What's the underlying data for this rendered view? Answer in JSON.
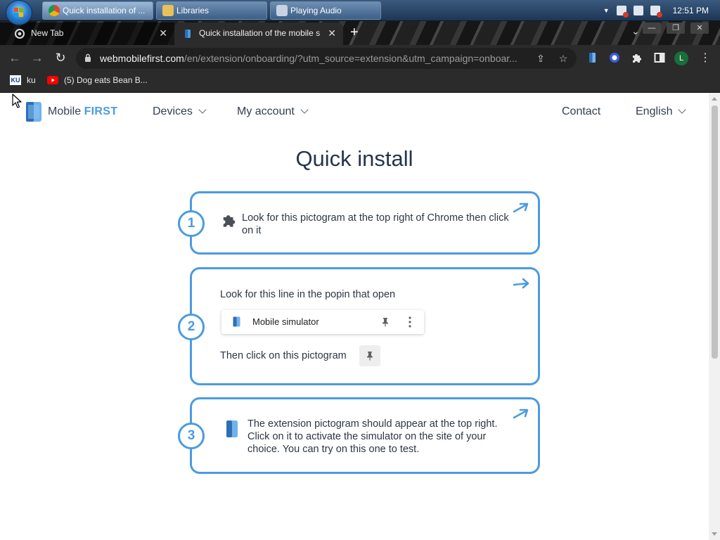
{
  "taskbar": {
    "tasks": [
      {
        "label": "Quick installation of ..."
      },
      {
        "label": "Libraries"
      },
      {
        "label": "Playing Audio"
      }
    ],
    "clock": "12:51 PM"
  },
  "browser": {
    "tabs": [
      {
        "title": "New Tab"
      },
      {
        "title": "Quick installation of the mobile s"
      }
    ],
    "url_host": "webmobilefirst.com",
    "url_rest": "/en/extension/onboarding/?utm_source=extension&utm_campaign=onboar...",
    "profile_initial": "L",
    "bookmarks": [
      {
        "label": "ku",
        "icon": "ku-favicon"
      },
      {
        "label": "(5) Dog eats Bean B...",
        "icon": "youtube-icon"
      }
    ]
  },
  "site": {
    "logo_text_1": "Mobile",
    "logo_text_2": "FIRST",
    "nav": {
      "devices": "Devices",
      "account": "My account",
      "contact": "Contact",
      "language": "English"
    },
    "title": "Quick install",
    "steps": [
      {
        "number": "1",
        "text": "Look for this pictogram at the top right of Chrome then click on it"
      },
      {
        "number": "2",
        "text_top": "Look for this line in the popin that open",
        "popin_label": "Mobile simulator",
        "text_bottom": "Then click on this pictogram"
      },
      {
        "number": "3",
        "text": "The extension pictogram should appear at the top right. Click on it to activate the simulator on the site of your choice. You can try on this one to test."
      }
    ]
  },
  "colors": {
    "accent": "#4b9be0",
    "heading": "#26344a",
    "chrome_dark": "#2b2b2b"
  }
}
